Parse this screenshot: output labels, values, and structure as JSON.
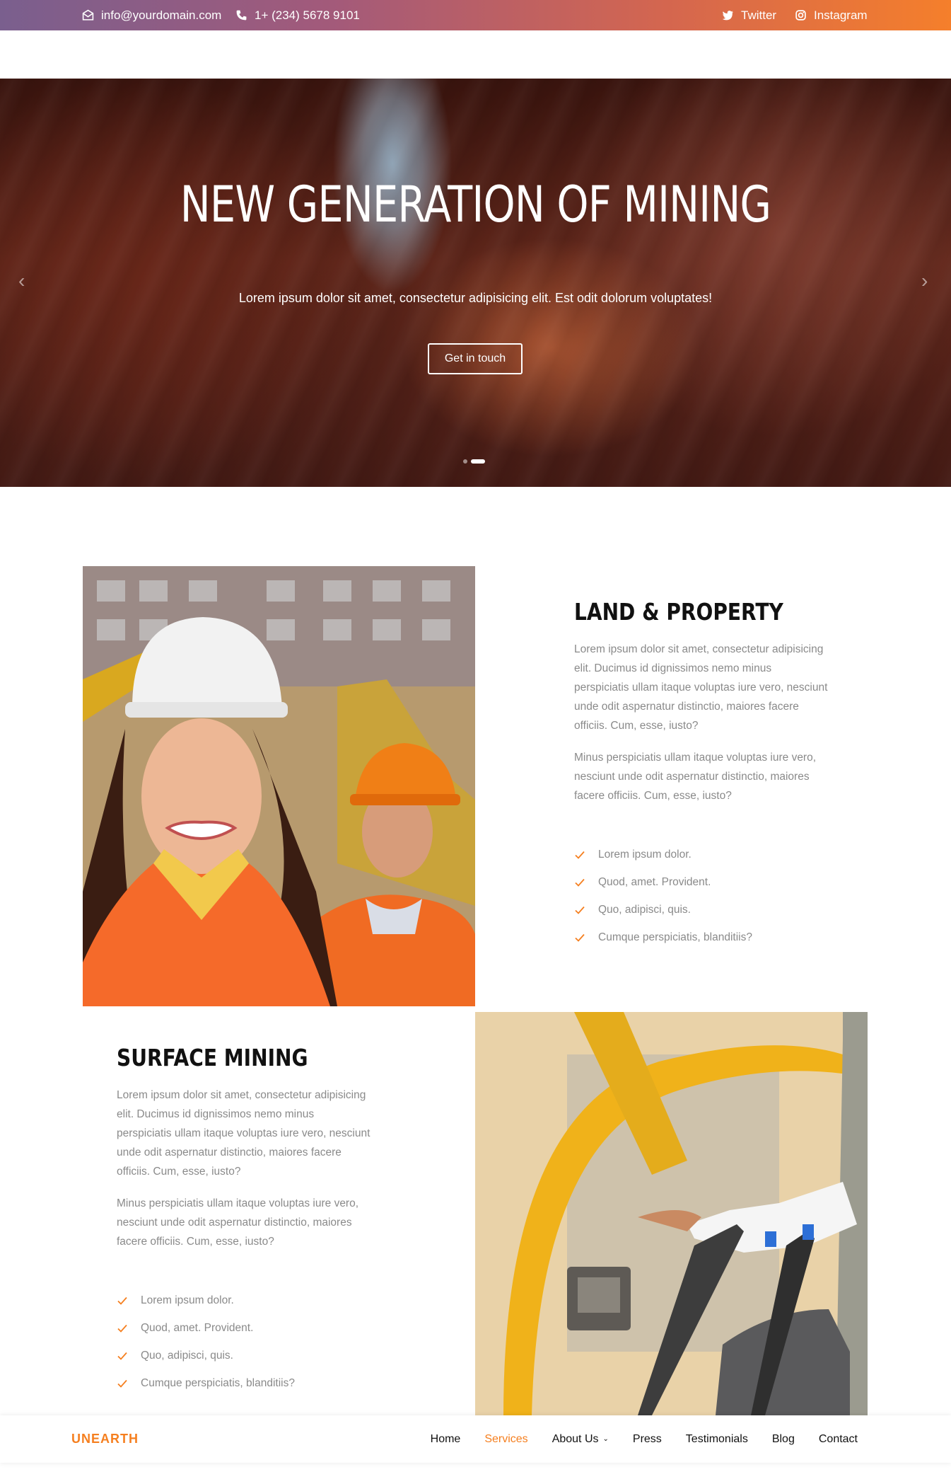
{
  "topbar": {
    "email": "info@yourdomain.com",
    "phone": "1+ (234) 5678 9101",
    "twitter_label": "Twitter",
    "instagram_label": "Instagram",
    "email_icon": "envelope-icon",
    "phone_icon": "phone-icon",
    "twitter_icon": "twitter-icon",
    "instagram_icon": "instagram-icon"
  },
  "hero": {
    "title": "New Generation of Mining",
    "subtitle": "Lorem ipsum dolor sit amet, consectetur adipisicing elit. Est odit dolorum voluptates!",
    "button_label": "Get in touch",
    "prev_icon": "chevron-left-icon",
    "next_icon": "chevron-right-icon",
    "slides_count": 2,
    "active_slide": 2
  },
  "land": {
    "title": "Land & Property",
    "para1": "Lorem ipsum dolor sit amet, consectetur adipisicing elit. Ducimus id dignissimos nemo minus perspiciatis ullam itaque voluptas iure vero, nesciunt unde odit aspernatur distinctio, maiores facere officiis. Cum, esse, iusto?",
    "para2": "Minus perspiciatis ullam itaque voluptas iure vero, nesciunt unde odit aspernatur distinctio, maiores facere officiis. Cum, esse, iusto?",
    "items": [
      "Lorem ipsum dolor.",
      "Quod, amet. Provident.",
      "Quo, adipisci, quis.",
      "Cumque perspiciatis, blanditiis?"
    ]
  },
  "surface": {
    "title": "Surface Mining",
    "para1": "Lorem ipsum dolor sit amet, consectetur adipisicing elit. Ducimus id dignissimos nemo minus perspiciatis ullam itaque voluptas iure vero, nesciunt unde odit aspernatur distinctio, maiores facere officiis. Cum, esse, iusto?",
    "para2": "Minus perspiciatis ullam itaque voluptas iure vero, nesciunt unde odit aspernatur distinctio, maiores facere officiis. Cum, esse, iusto?",
    "items": [
      "Lorem ipsum dolor.",
      "Quod, amet. Provident.",
      "Quo, adipisci, quis.",
      "Cumque perspiciatis, blanditiis?"
    ]
  },
  "nav": {
    "logo": "UNEARTH",
    "links": [
      "Home",
      "Services",
      "About Us",
      "Press",
      "Testimonials",
      "Blog",
      "Contact"
    ],
    "active": "Services"
  },
  "colors": {
    "accent": "#f57f1f",
    "gradient_start": "#7a5f8e",
    "gradient_end": "#f57f2b",
    "muted_text": "#8a8a8a"
  }
}
